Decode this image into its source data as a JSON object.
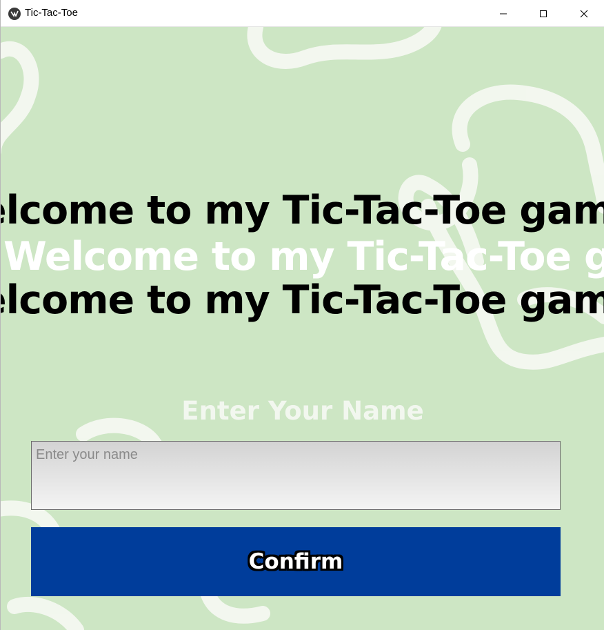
{
  "window": {
    "title": "Tic-Tac-Toe",
    "icon": "kivy-app-icon",
    "controls": [
      "minimize-icon",
      "maximize-icon",
      "close-icon"
    ]
  },
  "welcome": {
    "line_1": "elcome to my Tic-Tac-Toe gam",
    "line_2": "Welcome to my Tic-Tac-Toe game!",
    "line_3": "elcome to my Tic-Tac-Toe gam"
  },
  "form": {
    "heading": "Enter Your Name",
    "name_input": {
      "value": "",
      "placeholder": "Enter your name"
    },
    "confirm_label": "Confirm"
  },
  "colors": {
    "background": "#cde6c4",
    "decoration": "#f4f8f1",
    "button": "#003d9b",
    "heading": "#f2f7ef"
  }
}
